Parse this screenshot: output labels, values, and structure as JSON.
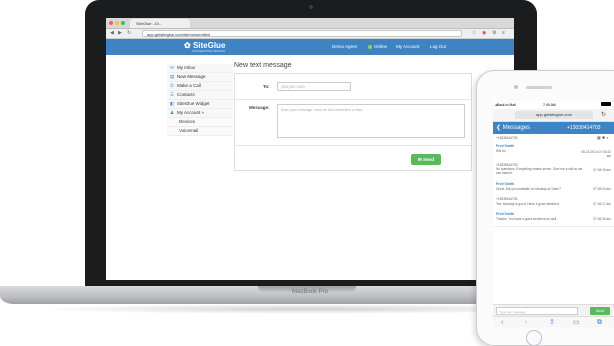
{
  "laptop": {
    "brand_label": "MacBook Pro",
    "browser": {
      "tab_title": "SiteGlue - Di...",
      "url": "app.getsiteglue.com/demo/sendtext"
    },
    "site": {
      "logo": "SiteGlue",
      "logo_tagline": "CONNECTING PEOPLE",
      "header_links": {
        "demo_agent": "Demo Agent",
        "online": "Online",
        "my_account": "My Account",
        "logout": "Log Out"
      },
      "sidebar": [
        {
          "label": "My Inbox",
          "icon": "inbox-icon"
        },
        {
          "label": "New Message",
          "icon": "compose-icon"
        },
        {
          "label": "Make a Call",
          "icon": "phone-icon"
        },
        {
          "label": "Contacts",
          "icon": "contacts-icon"
        },
        {
          "label": "SiteGlue Widget",
          "icon": "widget-icon"
        },
        {
          "label": "My Account",
          "icon": "account-icon",
          "chevron": "»"
        },
        {
          "label": "Devices",
          "icon": ""
        },
        {
          "label": "Voicemail",
          "icon": ""
        }
      ],
      "page_title": "New text message",
      "to_label": "To:",
      "to_placeholder": "(555) 867-5309",
      "message_label": "Message:",
      "message_placeholder": "Enter your message, must be 160 characters or less.",
      "send_label": "Send"
    }
  },
  "phone": {
    "status": {
      "left": "◂Back to Mail",
      "time": "7:49 AM"
    },
    "address": "app.getsiteglue.com",
    "header": {
      "back_label": "Messages",
      "number": "+13039414703"
    },
    "top_number": "+13039414703",
    "messages": [
      {
        "phone": "",
        "name": "Fred Smith",
        "text": "Will do",
        "time": "06-15-2014 07:03:22 am"
      },
      {
        "phone": "+13039414703",
        "name": "",
        "text": "No questions. Everything makes sense. Give me a call so we can started.",
        "time": "07:45:15 am"
      },
      {
        "phone": "",
        "name": "Fred Smith",
        "text": "Great. Are you available on Monday at 10am?",
        "time": "07:45:44 am"
      },
      {
        "phone": "+13039414703",
        "name": "",
        "text": "Yes. Monday is good. Have a good weekend.",
        "time": "07:46:17 am"
      },
      {
        "phone": "",
        "name": "Fred Smith",
        "text": "Thanks. You have a good weekend as well.",
        "time": "07:46:36 am"
      }
    ],
    "composer_placeholder": "Type your message",
    "send_label": "Send"
  },
  "colors": {
    "brand_blue": "#3e83c3",
    "send_green": "#5cb85c",
    "online_green": "#7ed957"
  }
}
